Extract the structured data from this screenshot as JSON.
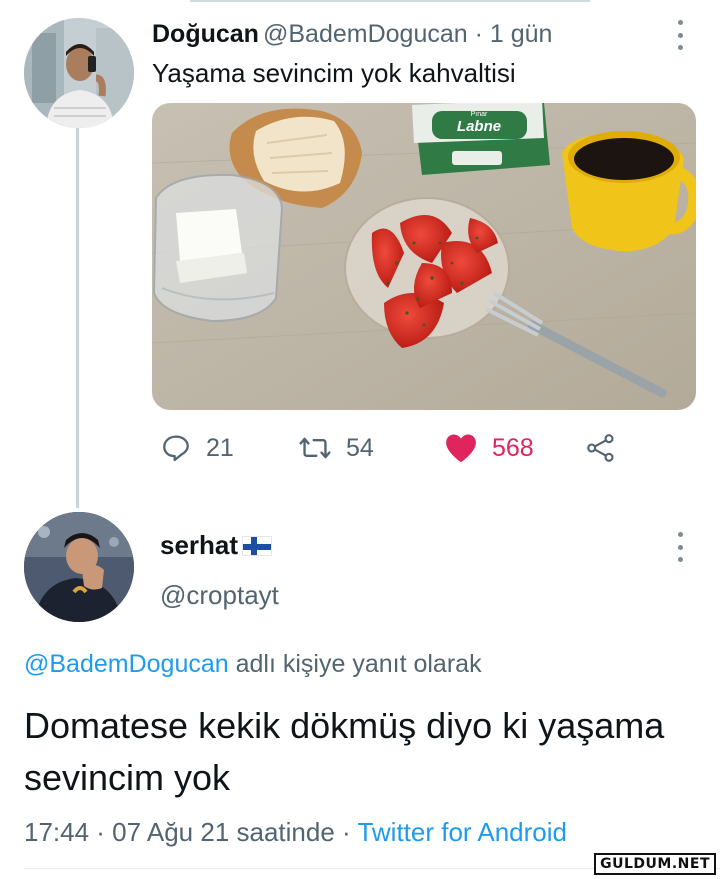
{
  "tweet": {
    "author_name": "Doğucan",
    "author_meta": "@BademDogucan · 1 gün",
    "text": "Yaşama sevincim yok kahvaltisi",
    "photo": {
      "labne_brand": "Pınar",
      "labne_label": "Labne"
    },
    "stats": {
      "replies": "21",
      "retweets": "54",
      "likes": "568"
    }
  },
  "reply": {
    "author_name": "serhat",
    "author_handle": "@croptayt",
    "reply_to_mention": "@BademDogucan",
    "reply_to_suffix": " adlı kişiye yanıt olarak",
    "text": "Domatese kekik dökmüş diyo ki yaşama sevincim yok",
    "time": "17:44 · 07 Ağu 21 saatinde · ",
    "source": "Twitter for Android"
  },
  "watermark": "GULDUM.NET",
  "colors": {
    "link": "#1d9bf0",
    "like": "#e0245e",
    "muted": "#536471"
  }
}
